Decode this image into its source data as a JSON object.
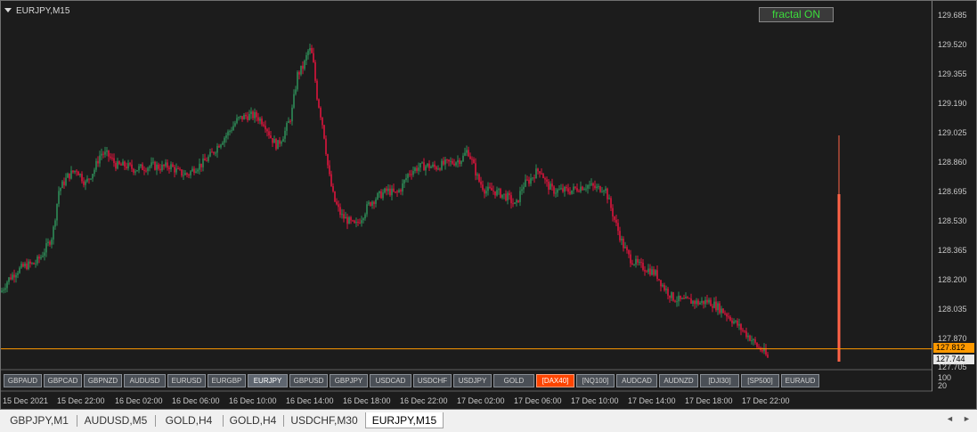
{
  "chart_title": "EURJPY,M15",
  "fractal_button": "fractal ON",
  "price_ticks": [
    "129.685",
    "129.520",
    "129.355",
    "129.190",
    "129.025",
    "128.860",
    "128.695",
    "128.530",
    "128.365",
    "128.200",
    "128.035",
    "127.870",
    "127.705"
  ],
  "price_tags": {
    "bid": "127.812",
    "last": "127.744"
  },
  "indicator_ticks": [
    "100",
    "20"
  ],
  "time_ticks": [
    "15 Dec 2021",
    "15 Dec 22:00",
    "16 Dec 02:00",
    "16 Dec 06:00",
    "16 Dec 10:00",
    "16 Dec 14:00",
    "16 Dec 18:00",
    "16 Dec 22:00",
    "17 Dec 02:00",
    "17 Dec 06:00",
    "17 Dec 10:00",
    "17 Dec 14:00",
    "17 Dec 18:00",
    "17 Dec 22:00"
  ],
  "symbol_buttons": [
    {
      "label": "GBPAUD",
      "state": "normal"
    },
    {
      "label": "GBPCAD",
      "state": "normal"
    },
    {
      "label": "GBPNZD",
      "state": "normal"
    },
    {
      "label": "AUDUSD",
      "state": "normal"
    },
    {
      "label": "EURUSD",
      "state": "normal"
    },
    {
      "label": "EURGBP",
      "state": "normal"
    },
    {
      "label": "EURJPY",
      "state": "active"
    },
    {
      "label": "GBPUSD",
      "state": "normal"
    },
    {
      "label": "GBPJPY",
      "state": "normal"
    },
    {
      "label": "USDCAD",
      "state": "normal"
    },
    {
      "label": "USDCHF",
      "state": "normal"
    },
    {
      "label": "USDJPY",
      "state": "normal"
    },
    {
      "label": "GOLD",
      "state": "normal"
    },
    {
      "label": "[DAX40]",
      "state": "hot"
    },
    {
      "label": "[NQ100]",
      "state": "normal"
    },
    {
      "label": "AUDCAD",
      "state": "normal"
    },
    {
      "label": "AUDNZD",
      "state": "normal"
    },
    {
      "label": "[DJI30]",
      "state": "normal"
    },
    {
      "label": "[SP500]",
      "state": "normal"
    },
    {
      "label": "EURAUD",
      "state": "normal"
    }
  ],
  "tabs": [
    {
      "label": "GBPJPY,M1",
      "active": false
    },
    {
      "label": "AUDUSD,M5",
      "active": false
    },
    {
      "label": "GOLD,H4",
      "active": false
    },
    {
      "label": "GOLD,H4",
      "active": false
    },
    {
      "label": "USDCHF,M30",
      "active": false
    },
    {
      "label": "EURJPY,M15",
      "active": true
    }
  ],
  "scroll_arrows": {
    "left": "◄",
    "right": "►"
  },
  "colors": {
    "bull": "#2e8b57",
    "bear": "#dc143c",
    "bid_line": "#ff9900",
    "spike": "#ff6347",
    "background": "#1c1c1c"
  },
  "chart_data": {
    "type": "candlestick",
    "symbol": "EURJPY",
    "timeframe": "M15",
    "ylim": [
      127.705,
      129.685
    ],
    "path": [
      [
        0,
        128.13
      ],
      [
        8,
        128.2
      ],
      [
        18,
        128.25
      ],
      [
        28,
        128.28
      ],
      [
        38,
        128.29
      ],
      [
        45,
        128.33
      ],
      [
        52,
        128.39
      ],
      [
        58,
        128.45
      ],
      [
        65,
        128.7
      ],
      [
        75,
        128.78
      ],
      [
        85,
        128.82
      ],
      [
        95,
        128.74
      ],
      [
        105,
        128.82
      ],
      [
        112,
        128.91
      ],
      [
        120,
        128.9
      ],
      [
        130,
        128.84
      ],
      [
        140,
        128.84
      ],
      [
        150,
        128.82
      ],
      [
        160,
        128.83
      ],
      [
        170,
        128.84
      ],
      [
        180,
        128.83
      ],
      [
        190,
        128.84
      ],
      [
        200,
        128.8
      ],
      [
        210,
        128.79
      ],
      [
        218,
        128.83
      ],
      [
        226,
        128.85
      ],
      [
        236,
        128.9
      ],
      [
        246,
        128.97
      ],
      [
        256,
        129.03
      ],
      [
        266,
        129.1
      ],
      [
        276,
        129.12
      ],
      [
        286,
        129.12
      ],
      [
        296,
        129.08
      ],
      [
        303,
        129.0
      ],
      [
        310,
        128.95
      ],
      [
        318,
        129.02
      ],
      [
        326,
        129.12
      ],
      [
        333,
        129.35
      ],
      [
        340,
        129.4
      ],
      [
        346,
        129.5
      ],
      [
        350,
        129.45
      ],
      [
        355,
        129.23
      ],
      [
        362,
        129.05
      ],
      [
        368,
        128.8
      ],
      [
        374,
        128.65
      ],
      [
        382,
        128.56
      ],
      [
        390,
        128.53
      ],
      [
        398,
        128.5
      ],
      [
        406,
        128.56
      ],
      [
        414,
        128.63
      ],
      [
        424,
        128.67
      ],
      [
        434,
        128.7
      ],
      [
        444,
        128.68
      ],
      [
        450,
        128.72
      ],
      [
        458,
        128.8
      ],
      [
        468,
        128.83
      ],
      [
        478,
        128.84
      ],
      [
        488,
        128.83
      ],
      [
        498,
        128.85
      ],
      [
        508,
        128.86
      ],
      [
        518,
        128.88
      ],
      [
        524,
        128.93
      ],
      [
        530,
        128.85
      ],
      [
        536,
        128.76
      ],
      [
        544,
        128.7
      ],
      [
        552,
        128.7
      ],
      [
        562,
        128.68
      ],
      [
        570,
        128.66
      ],
      [
        578,
        128.61
      ],
      [
        586,
        128.73
      ],
      [
        594,
        128.76
      ],
      [
        600,
        128.8
      ],
      [
        606,
        128.82
      ],
      [
        612,
        128.74
      ],
      [
        620,
        128.7
      ],
      [
        630,
        128.7
      ],
      [
        640,
        128.7
      ],
      [
        650,
        128.72
      ],
      [
        660,
        128.73
      ],
      [
        670,
        128.71
      ],
      [
        678,
        128.72
      ],
      [
        684,
        128.62
      ],
      [
        690,
        128.52
      ],
      [
        698,
        128.4
      ],
      [
        706,
        128.32
      ],
      [
        716,
        128.28
      ],
      [
        726,
        128.26
      ],
      [
        736,
        128.23
      ],
      [
        744,
        128.16
      ],
      [
        754,
        128.1
      ],
      [
        764,
        128.08
      ],
      [
        774,
        128.08
      ],
      [
        784,
        128.07
      ],
      [
        794,
        128.08
      ],
      [
        804,
        128.05
      ],
      [
        814,
        128.01
      ],
      [
        824,
        127.96
      ],
      [
        834,
        127.91
      ],
      [
        842,
        127.87
      ],
      [
        850,
        127.82
      ],
      [
        856,
        127.8
      ],
      [
        862,
        127.75
      ]
    ],
    "spike_candle": {
      "high": 129.01,
      "open": 128.68,
      "close": 127.74
    }
  }
}
